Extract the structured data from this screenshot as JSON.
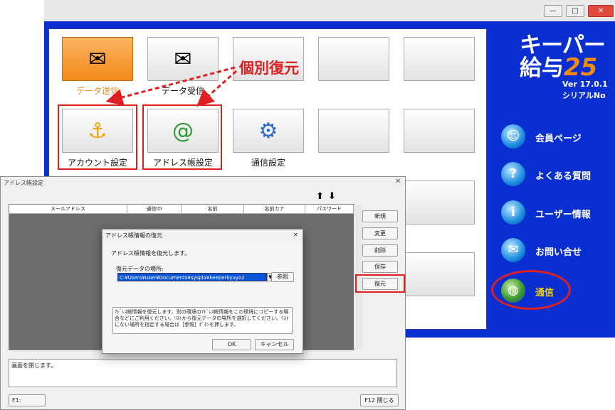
{
  "window": {
    "min": "—",
    "max": "□",
    "close": "✕"
  },
  "tiles": {
    "send": "データ送信",
    "receive": "データ受信",
    "account": "アカウント設定",
    "address": "アドレス帳設定",
    "comm": "通信設定"
  },
  "annotation": "個別復元",
  "brand": {
    "line1": "キーパー",
    "line2": "給与",
    "number": "25",
    "version": "Ver 17.0.1",
    "serial": "シリアルNo"
  },
  "side": [
    "会員ページ",
    "よくある質問",
    "ユーザー情報",
    "お問い合せ",
    "通信"
  ],
  "addr": {
    "title": "アドレス帳設定",
    "columns": [
      "メールアドレス",
      "通信ID",
      "名前",
      "名前カナ",
      "パスワード"
    ],
    "buttons": [
      "新規",
      "変更",
      "削除",
      "保存",
      "復元"
    ],
    "message": "画面を閉じます。",
    "f1": "F1:",
    "f12": "F12 閉じる",
    "up": "⬆",
    "down": "⬇"
  },
  "restore": {
    "title": "アドレス帳情報の復元",
    "heading": "アドレス帳情報を復元します。",
    "location_label": "復元データの場所:",
    "path": "C:¥Users¥user¥Documents¥syspla¥keeperkyuyo2",
    "browse": "参照",
    "desc": "ｱﾄﾞﾚｽ帳情報を復元します。別の環境のｱﾄﾞﾚｽ帳情報をこの環境にコピーする場合などにご利用ください。ﾘｽﾄから復元データの場所を選択してください。ﾘｽﾄにない場所を指定する場合は［参照］ﾎﾞﾀﾝを押します。",
    "ok": "OK",
    "cancel": "キャンセル",
    "close": "✕"
  },
  "colors": {
    "brand_blue": "#0a2fd0",
    "accent_red": "#e02020",
    "orange": "#f28a1b"
  }
}
